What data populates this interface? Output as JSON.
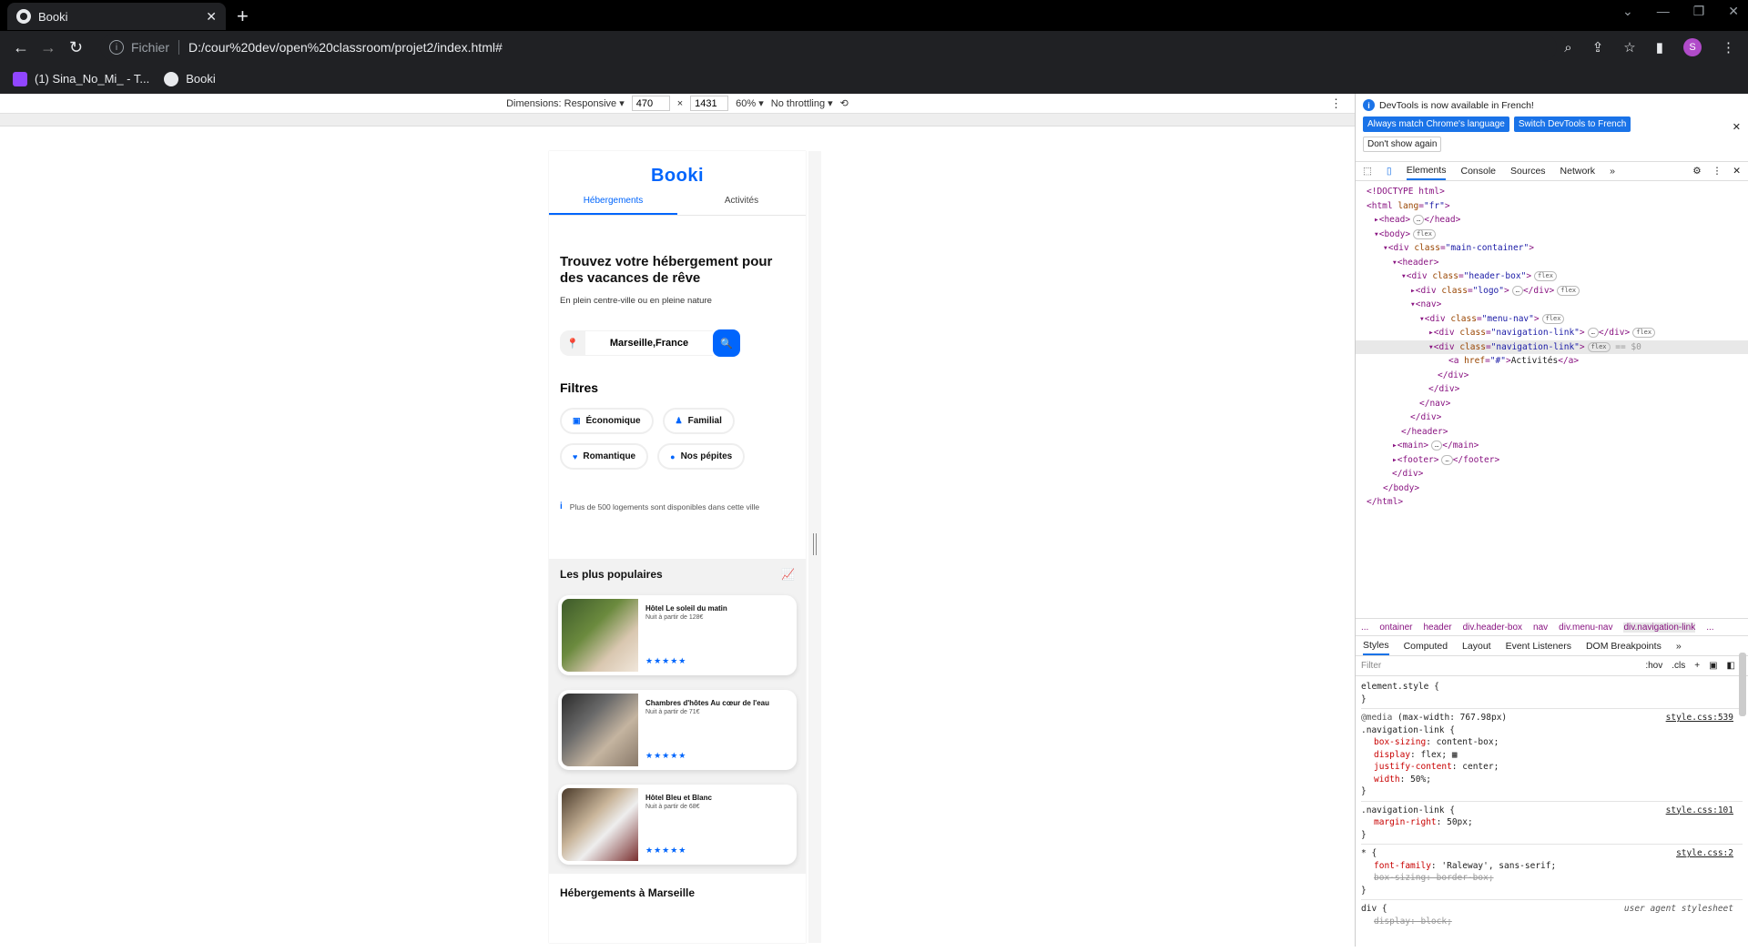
{
  "browser": {
    "tab_title": "Booki",
    "scheme": "Fichier",
    "url": "D:/cour%20dev/open%20classroom/projet2/index.html#",
    "profile_initial": "S",
    "bookmarks": [
      {
        "label": "(1) Sina_No_Mi_ - T...",
        "icon": "twitch-icon"
      },
      {
        "label": "Booki",
        "icon": "globe-icon"
      }
    ]
  },
  "device_toolbar": {
    "dimensions_label": "Dimensions: Responsive",
    "width": "470",
    "height": "1431",
    "times": "×",
    "zoom": "60%",
    "throttling": "No throttling"
  },
  "site": {
    "logo": "Booki",
    "nav": [
      "Hébergements",
      "Activités"
    ],
    "hero_title": "Trouvez votre hébergement pour des vacances de rêve",
    "hero_subtitle": "En plein centre-ville ou en pleine nature",
    "search_value": "Marseille,France",
    "filters_title": "Filtres",
    "filters": [
      {
        "label": "Économique",
        "icon": "money-icon"
      },
      {
        "label": "Familial",
        "icon": "child-icon"
      },
      {
        "label": "Romantique",
        "icon": "heart-icon"
      },
      {
        "label": "Nos pépites",
        "icon": "gem-icon"
      }
    ],
    "info_text": "Plus de 500 logements sont disponibles dans cette ville",
    "popular_title": "Les plus populaires",
    "cards": [
      {
        "name": "Hôtel Le soleil du matin",
        "price": "Nuit à partir de 128€",
        "stars": 5
      },
      {
        "name": "Chambres d'hôtes Au cœur de l'eau",
        "price": "Nuit à partir de 71€",
        "stars": 5
      },
      {
        "name": "Hôtel Bleu et Blanc",
        "price": "Nuit à partir de 68€",
        "stars": 5
      }
    ],
    "next_section": "Hébergements à Marseille"
  },
  "devtools": {
    "banner_message": "DevTools is now available in French!",
    "banner_btn1": "Always match Chrome's language",
    "banner_btn2": "Switch DevTools to French",
    "banner_dismiss": "Don't show again",
    "tabs": [
      "Elements",
      "Console",
      "Sources",
      "Network"
    ],
    "breadcrumbs": [
      "...",
      "ontainer",
      "header",
      "div.header-box",
      "nav",
      "div.menu-nav",
      "div.navigation-link",
      "..."
    ],
    "style_tabs": [
      "Styles",
      "Computed",
      "Layout",
      "Event Listeners",
      "DOM Breakpoints"
    ],
    "filter_placeholder": "Filter",
    "filter_hov": ":hov",
    "filter_cls": ".cls"
  },
  "colors": {
    "brand": "#0065fc",
    "devtools_accent": "#1a73e8"
  }
}
